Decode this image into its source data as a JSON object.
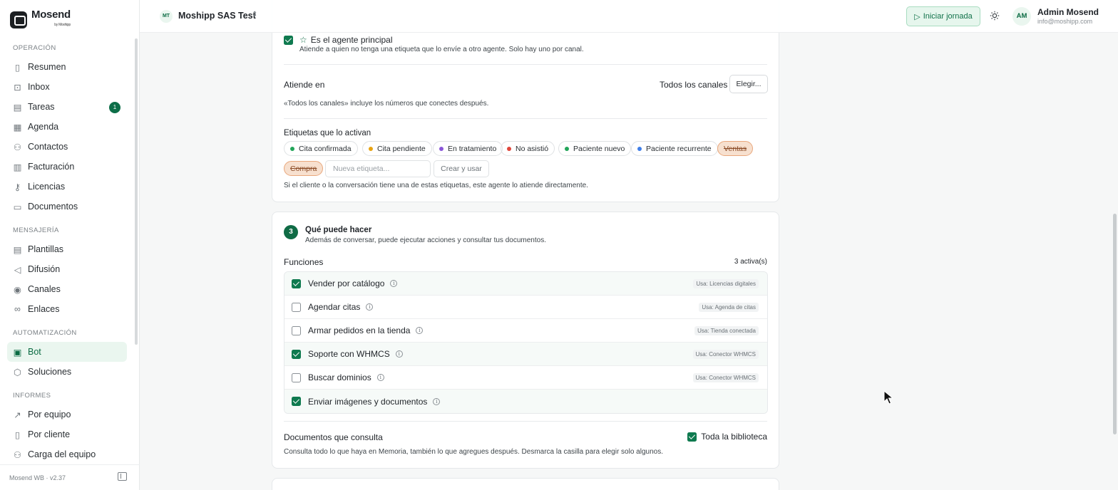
{
  "brand": {
    "name": "Mosend",
    "sub": "by Moshipp"
  },
  "sidebar": {
    "sections": [
      {
        "title": "OPERACIÓN",
        "items": [
          {
            "label": "Resumen",
            "icon": "bar-chart-icon"
          },
          {
            "label": "Inbox",
            "icon": "inbox-icon"
          },
          {
            "label": "Tareas",
            "icon": "clipboard-icon",
            "badge": "1"
          },
          {
            "label": "Agenda",
            "icon": "calendar-icon"
          },
          {
            "label": "Contactos",
            "icon": "users-icon"
          },
          {
            "label": "Facturación",
            "icon": "receipt-icon"
          },
          {
            "label": "Licencias",
            "icon": "key-icon"
          },
          {
            "label": "Documentos",
            "icon": "folder-icon"
          }
        ]
      },
      {
        "title": "MENSAJERÍA",
        "items": [
          {
            "label": "Plantillas",
            "icon": "file-text-icon"
          },
          {
            "label": "Difusión",
            "icon": "megaphone-icon"
          },
          {
            "label": "Canales",
            "icon": "radio-icon"
          },
          {
            "label": "Enlaces",
            "icon": "link-icon"
          }
        ]
      },
      {
        "title": "AUTOMATIZACIÓN",
        "items": [
          {
            "label": "Bot",
            "icon": "bot-icon",
            "active": true
          },
          {
            "label": "Soluciones",
            "icon": "box-icon"
          }
        ]
      },
      {
        "title": "INFORMES",
        "items": [
          {
            "label": "Por equipo",
            "icon": "trend-icon"
          },
          {
            "label": "Por cliente",
            "icon": "bar-chart-icon"
          },
          {
            "label": "Carga del equipo",
            "icon": "user-load-icon"
          }
        ]
      }
    ],
    "footer": "Mosend WB · v2.37"
  },
  "topbar": {
    "org_initials": "MT",
    "org_name": "Moshipp SAS Test",
    "start_shift": "Iniciar jornada",
    "user_initials": "AM",
    "user_name": "Admin Mosend",
    "user_email": "info@moshipp.com"
  },
  "card1": {
    "main_agent_label": "Es el agente principal",
    "main_agent_checked": true,
    "main_agent_help": "Atiende a quien no tenga una etiqueta que lo envíe a otro agente. Solo hay uno por canal.",
    "attends_in_label": "Atiende en",
    "attends_in_value": "Todos los canales",
    "choose_button": "Elegir...",
    "attends_in_help": "«Todos los canales» incluye los números que conectes después.",
    "tags_title": "Etiquetas que lo activan",
    "tags": [
      {
        "label": "Cita confirmada",
        "color": "#22a559"
      },
      {
        "label": "Cita pendiente",
        "color": "#e8a311"
      },
      {
        "label": "En tratamiento",
        "color": "#8a56d8"
      },
      {
        "label": "No asistió",
        "color": "#e0453a"
      },
      {
        "label": "Paciente nuevo",
        "color": "#22a559"
      },
      {
        "label": "Paciente recurrente",
        "color": "#3f7ee8"
      },
      {
        "label": "Ventas",
        "removed": true
      },
      {
        "label": "Compra",
        "removed": true
      }
    ],
    "new_tag_placeholder": "Nueva etiqueta...",
    "create_button": "Crear y usar",
    "tags_help": "Si el cliente o la conversación tiene una de estas etiquetas, este agente lo atiende directamente."
  },
  "card2": {
    "step": "3",
    "title": "Qué puede hacer",
    "subtitle": "Además de conversar, puede ejecutar acciones y consultar tus documentos.",
    "functions_title": "Funciones",
    "functions_count": "3 activa(s)",
    "functions": [
      {
        "label": "Vender por catálogo",
        "checked": true,
        "uses": "Usa: Licencias digitales"
      },
      {
        "label": "Agendar citas",
        "checked": false,
        "uses": "Usa: Agenda de citas"
      },
      {
        "label": "Armar pedidos en la tienda",
        "checked": false,
        "uses": "Usa: Tienda conectada"
      },
      {
        "label": "Soporte con WHMCS",
        "checked": true,
        "uses": "Usa: Conector WHMCS"
      },
      {
        "label": "Buscar dominios",
        "checked": false,
        "uses": "Usa: Conector WHMCS"
      },
      {
        "label": "Enviar imágenes y documentos",
        "checked": true,
        "uses": ""
      }
    ],
    "docs_title": "Documentos que consulta",
    "whole_library_label": "Toda la biblioteca",
    "whole_library_checked": true,
    "docs_help": "Consulta todo lo que haya en Memoria, también lo que agregues después. Desmarca la casilla para elegir solo algunos."
  },
  "colors": {
    "accent": "#0f7a4f",
    "accent_bg": "#eaf6ef"
  }
}
